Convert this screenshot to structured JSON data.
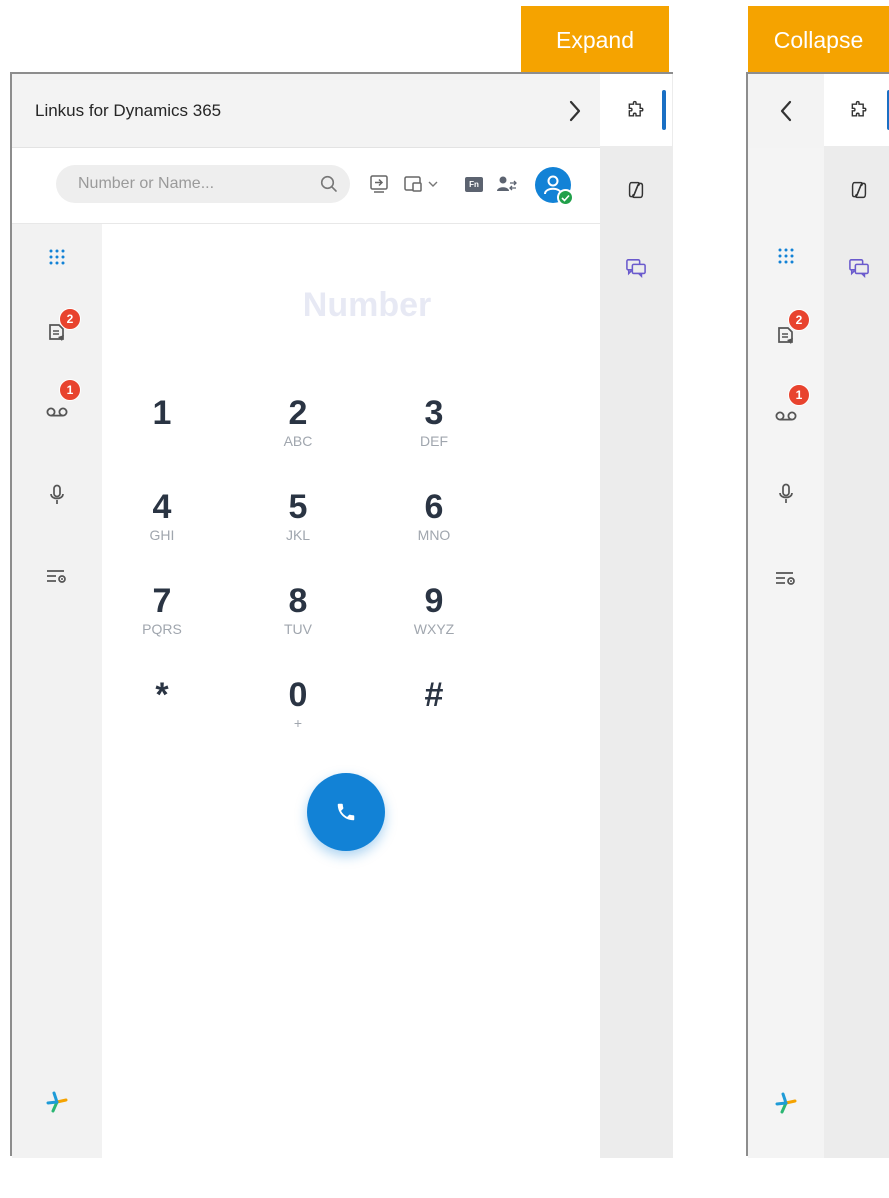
{
  "labels": {
    "expand": "Expand",
    "collapse": "Collapse"
  },
  "header": {
    "title": "Linkus for Dynamics 365"
  },
  "search": {
    "placeholder": "Number or Name..."
  },
  "toolbar": {
    "fn_label": "Fn"
  },
  "nav": {
    "items": [
      {
        "name": "dialpad",
        "icon": "dialpad-icon",
        "active": true
      },
      {
        "name": "call-logs",
        "icon": "call-log-icon",
        "badge": "2"
      },
      {
        "name": "voicemail",
        "icon": "voicemail-icon",
        "badge": "1"
      },
      {
        "name": "recordings",
        "icon": "microphone-icon"
      },
      {
        "name": "settings",
        "icon": "list-settings-icon"
      }
    ]
  },
  "dialpad": {
    "placeholder": "Number",
    "keys": [
      {
        "digit": "1",
        "letters": ""
      },
      {
        "digit": "2",
        "letters": "ABC"
      },
      {
        "digit": "3",
        "letters": "DEF"
      },
      {
        "digit": "4",
        "letters": "GHI"
      },
      {
        "digit": "5",
        "letters": "JKL"
      },
      {
        "digit": "6",
        "letters": "MNO"
      },
      {
        "digit": "7",
        "letters": "PQRS"
      },
      {
        "digit": "8",
        "letters": "TUV"
      },
      {
        "digit": "9",
        "letters": "WXYZ"
      },
      {
        "digit": "*",
        "letters": ""
      },
      {
        "digit": "0",
        "letters": "+"
      },
      {
        "digit": "#",
        "letters": ""
      }
    ]
  },
  "colors": {
    "accent": "#1282d6",
    "tag": "#f5a300",
    "badge": "#e8432e",
    "presence": "#21a04a"
  }
}
